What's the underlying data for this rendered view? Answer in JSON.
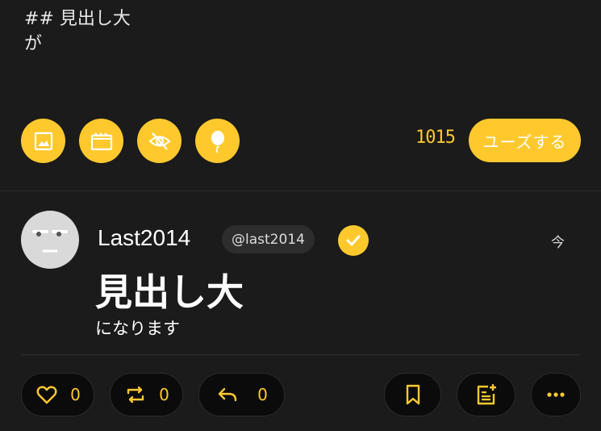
{
  "composer": {
    "line1": "## 見出し大",
    "line2": "が"
  },
  "toolbar": {
    "icons": [
      "image-icon",
      "video-icon",
      "eye-off-icon",
      "balloon-icon"
    ],
    "char_count": "1015",
    "submit_label": "ユーズする"
  },
  "post": {
    "username": "Last2014",
    "handle": "@last2014",
    "timestamp": "今",
    "heading": "見出し大",
    "body": "になります",
    "actions": {
      "like_count": "0",
      "repost_count": "0",
      "reply_count": "0"
    }
  },
  "colors": {
    "accent": "#ffc92e",
    "background": "#1b1b1b",
    "button_dark": "#0b0b0b"
  }
}
